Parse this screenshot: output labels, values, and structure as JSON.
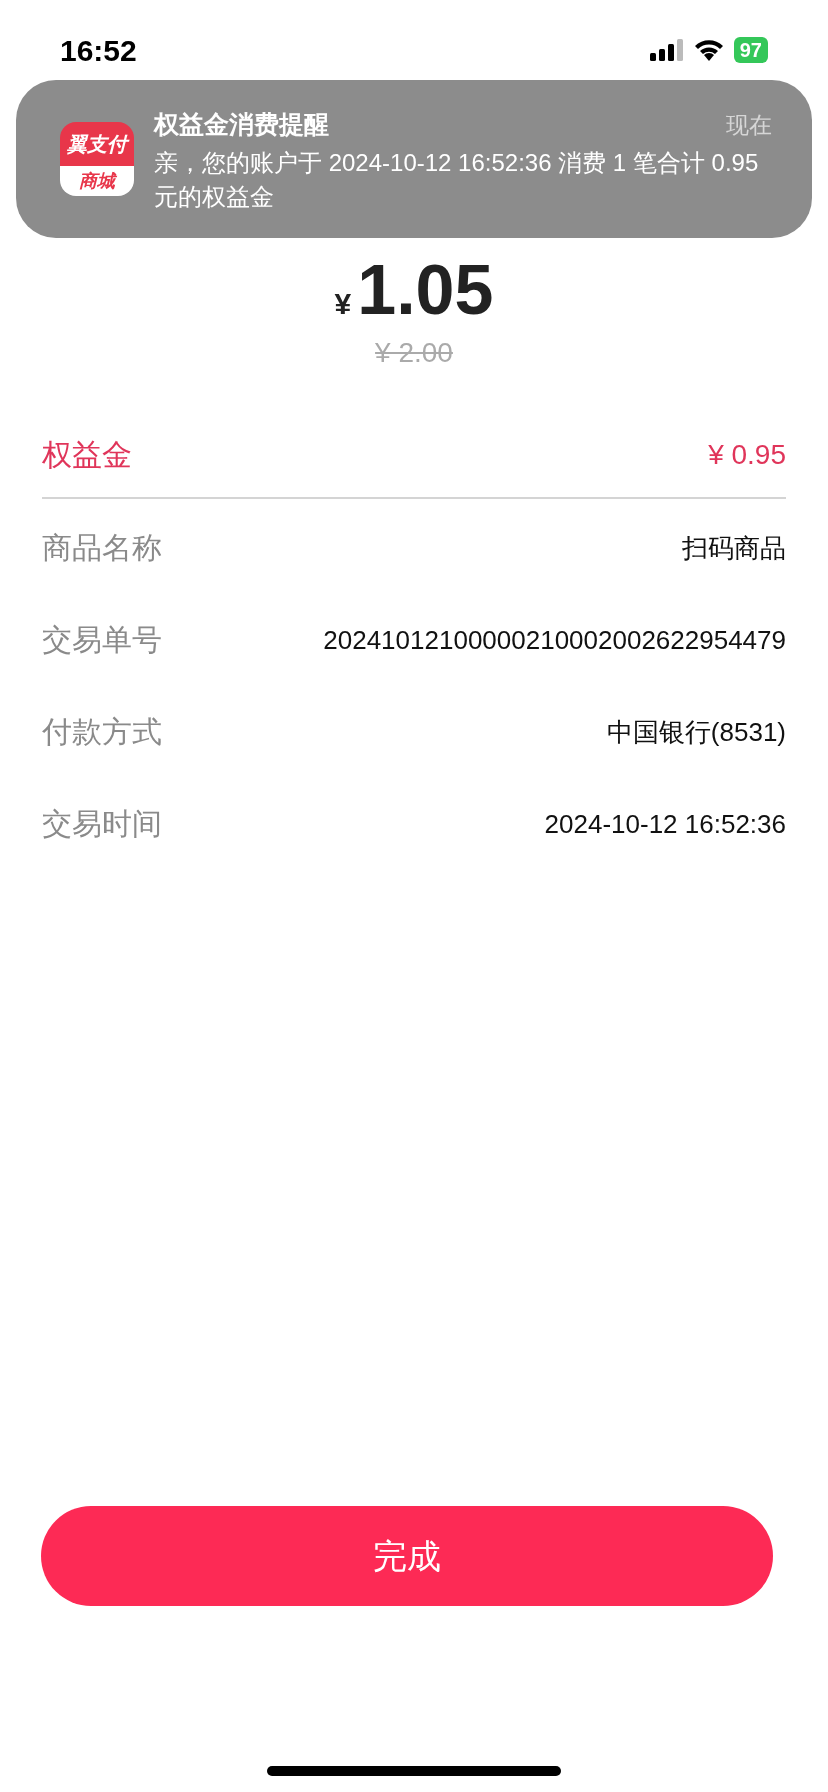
{
  "status_bar": {
    "time": "16:52",
    "battery": "97"
  },
  "notification": {
    "title": "权益金消费提醒",
    "time": "现在",
    "body": "亲，您的账户于 2024-10-12 16:52:36 消费 1 笔合计 0.95 元的权益金",
    "app_icon": {
      "top": "翼支付",
      "bottom": "商城"
    }
  },
  "amount": {
    "currency": "¥",
    "value": "1.05",
    "original": "¥ 2.00"
  },
  "benefit": {
    "label": "权益金",
    "value": "¥ 0.95"
  },
  "details": [
    {
      "label": "商品名称",
      "value": "扫码商品"
    },
    {
      "label": "交易单号",
      "value": "20241012100000210002002622954479"
    },
    {
      "label": "付款方式",
      "value": "中国银行(8531)"
    },
    {
      "label": "交易时间",
      "value": "2024-10-12 16:52:36"
    }
  ],
  "done_button": "完成"
}
